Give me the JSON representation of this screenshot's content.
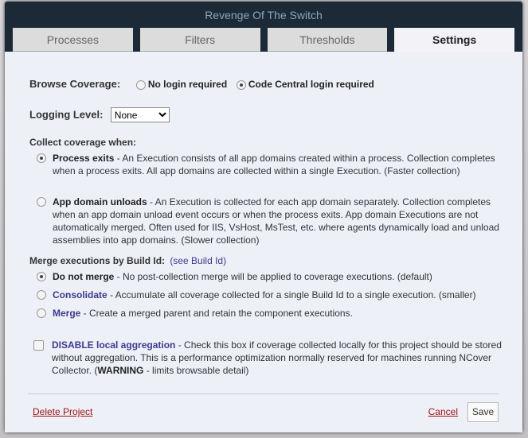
{
  "dialog": {
    "title": "Revenge Of The Switch"
  },
  "tabs": [
    {
      "label": "Processes"
    },
    {
      "label": "Filters"
    },
    {
      "label": "Thresholds"
    },
    {
      "label": "Settings",
      "active": true
    }
  ],
  "browse": {
    "label": "Browse Coverage:",
    "options": [
      "No login required",
      "Code Central login required"
    ],
    "selected": 1
  },
  "logging": {
    "label": "Logging Level:",
    "value": "None"
  },
  "collect": {
    "label": "Collect coverage when:",
    "options": [
      {
        "title": "Process exits",
        "desc": " - An Execution consists of all app domains created within a process. Collection completes when a process exits. All app domains are collected within a single Execution. (Faster collection)",
        "selected": true
      },
      {
        "title": "App domain unloads",
        "desc": " - An Execution is collected for each app domain separately. Collection completes when an app domain unload event occurs or when the process exits. App domain Executions are not automatically merged. Often used for IIS, VsHost, MsTest, etc. where agents dynamically load and unload assemblies into app domains. (Slower collection)",
        "selected": false
      }
    ]
  },
  "merge": {
    "label": "Merge executions by Build Id:",
    "link": "(see Build Id)",
    "options": [
      {
        "title": "Do not merge",
        "desc": " - No post-collection merge will be applied to coverage executions. (default)",
        "selected": true
      },
      {
        "title": "Consolidate",
        "desc": " - Accumulate all coverage collected for a single Build Id to a single execution. (smaller)",
        "selected": false
      },
      {
        "title": "Merge",
        "desc": " - Create a merged parent and retain the component executions.",
        "selected": false
      }
    ]
  },
  "disable": {
    "title": "DISABLE local aggregation",
    "desc1": " - Check this box if coverage collected locally for this project should be stored without aggregation. This is a performance optimization normally reserved for machines running NCover Collector. (",
    "warning": "WARNING",
    "desc2": " - limits browsable detail)",
    "checked": false
  },
  "footer": {
    "delete": "Delete Project",
    "cancel": "Cancel",
    "save": "Save"
  },
  "colors": {
    "titlebar": "#1c2a38",
    "link_red": "#9b1010",
    "accent_blue": "#3b3a8c"
  }
}
